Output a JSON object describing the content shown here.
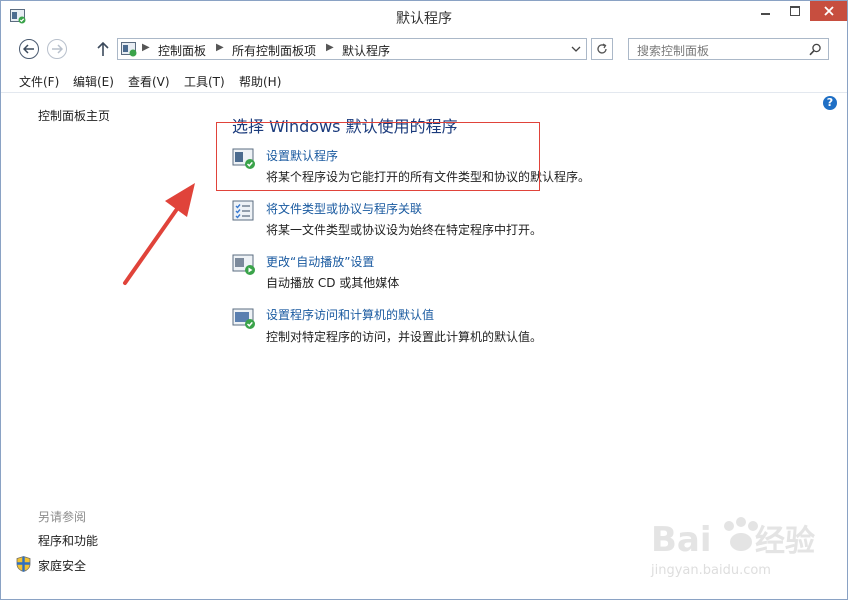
{
  "window": {
    "title": "默认程序",
    "accent_close": "#c74e3f"
  },
  "nav": {
    "breadcrumbs": [
      "控制面板",
      "所有控制面板项",
      "默认程序"
    ],
    "search_placeholder": "搜索控制面板"
  },
  "menu": [
    "文件(F)",
    "编辑(E)",
    "查看(V)",
    "工具(T)",
    "帮助(H)"
  ],
  "sidebar": {
    "home_link": "控制面板主页",
    "see_also_header": "另请参阅",
    "links": [
      "程序和功能",
      "家庭安全"
    ]
  },
  "main": {
    "title": "选择 Windows 默认使用的程序",
    "tasks": [
      {
        "link": "设置默认程序",
        "desc": "将某个程序设为它能打开的所有文件类型和协议的默认程序。",
        "icon": "default-programs-icon"
      },
      {
        "link": "将文件类型或协议与程序关联",
        "desc": "将某一文件类型或协议设为始终在特定程序中打开。",
        "icon": "file-association-icon"
      },
      {
        "link": "更改“自动播放”设置",
        "desc": "自动播放 CD 或其他媒体",
        "icon": "autoplay-icon"
      },
      {
        "link": "设置程序访问和计算机的默认值",
        "desc": "控制对特定程序的访问，并设置此计算机的默认值。",
        "icon": "program-access-icon"
      }
    ]
  },
  "annotation_colors": {
    "highlight_box": "#e0433a",
    "arrow": "#e0433a"
  },
  "watermark": {
    "logo_text": "Bai du 经验",
    "url": "jingyan.baidu.com"
  }
}
